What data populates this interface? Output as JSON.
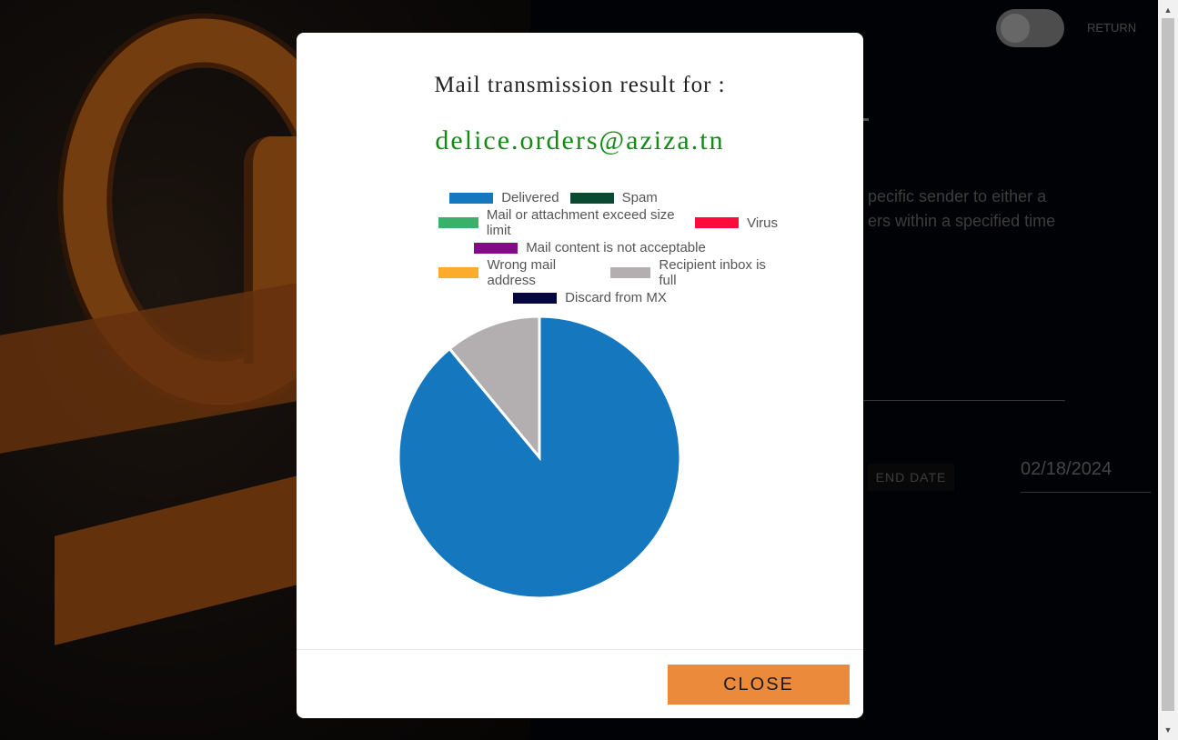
{
  "background": {
    "return_label": "RETURN",
    "description_lines": "pecific sender to either a\ners within a specified time",
    "end_date_label": "END DATE",
    "end_date_value": "02/18/2024"
  },
  "modal": {
    "title": "Mail transmission result for :",
    "email": "delice.orders@aziza.tn",
    "close_label": "CLOSE"
  },
  "chart_data": {
    "type": "pie",
    "legend_placement": "top",
    "legend": [
      {
        "label": "Delivered",
        "color": "#1577be"
      },
      {
        "label": "Spam",
        "color": "#0a4a32"
      },
      {
        "label": "Mail or attachment exceed size limit",
        "color": "#3ab06b"
      },
      {
        "label": "Virus",
        "color": "#ff0a3a"
      },
      {
        "label": "Mail content is not acceptable",
        "color": "#850a8a"
      },
      {
        "label": "Wrong mail address",
        "color": "#fdab2d"
      },
      {
        "label": "Recipient inbox is full",
        "color": "#b3aeb0"
      },
      {
        "label": "Discard from MX",
        "color": "#07073f"
      }
    ],
    "slices": [
      {
        "label": "Delivered",
        "value": 89,
        "color": "#1577be"
      },
      {
        "label": "Recipient inbox is full",
        "value": 11,
        "color": "#b3aeb0"
      }
    ]
  }
}
